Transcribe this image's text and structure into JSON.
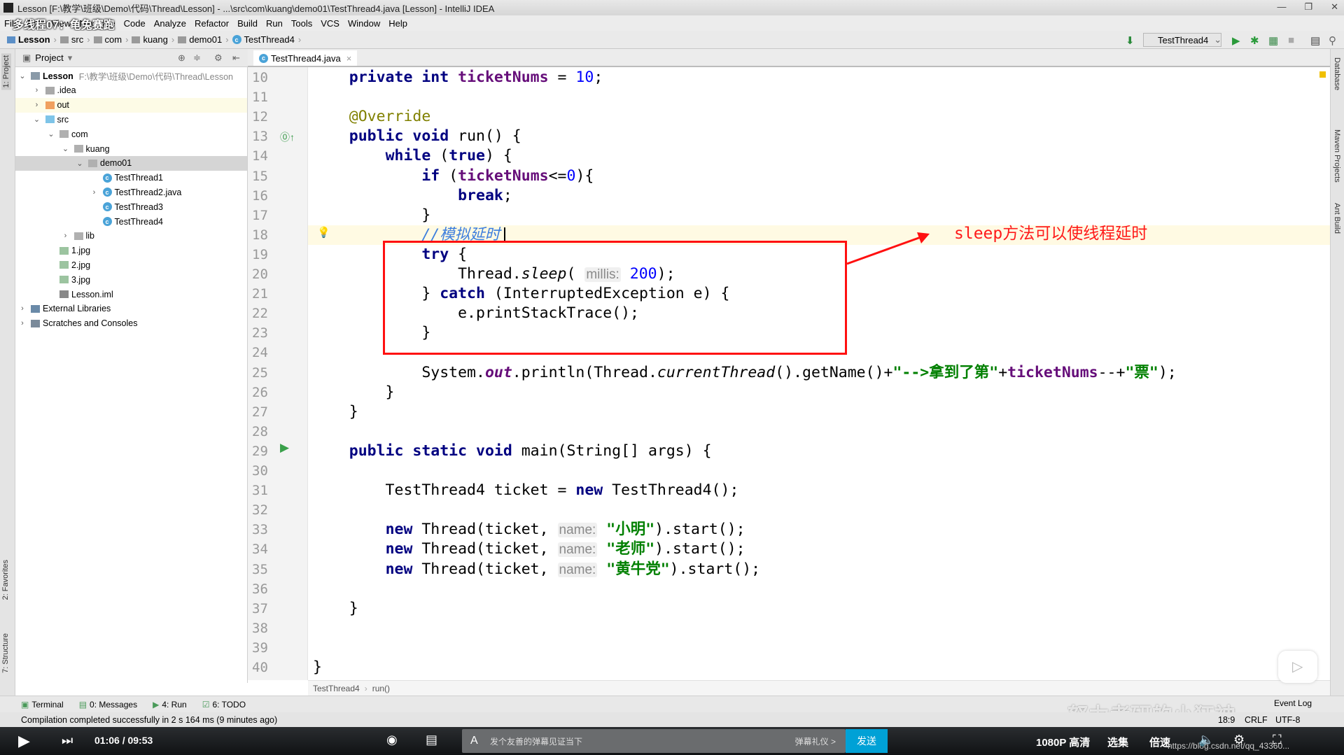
{
  "window": {
    "title": "Lesson [F:\\教学\\班级\\Demo\\代码\\Thread\\Lesson] - ...\\src\\com\\kuang\\demo01\\TestThread4.java [Lesson] - IntelliJ IDEA"
  },
  "video_title": "多线程07：龟兔赛跑",
  "menu": [
    "File",
    "Edit",
    "View",
    "Navigate",
    "Code",
    "Analyze",
    "Refactor",
    "Build",
    "Run",
    "Tools",
    "VCS",
    "Window",
    "Help"
  ],
  "breadcrumb": [
    "Lesson",
    "src",
    "com",
    "kuang",
    "demo01",
    "TestThread4"
  ],
  "run_config": "TestThread4",
  "side_tabs": {
    "project": "1: Project",
    "favorites": "2: Favorites",
    "structure": "7: Structure",
    "database": "Database",
    "maven": "Maven Projects",
    "ant": "Ant Build"
  },
  "project_panel": {
    "title": "Project",
    "tree": [
      {
        "label": "Lesson",
        "path": "F:\\教学\\班级\\Demo\\代码\\Thread\\Lesson",
        "level": 0,
        "arrow": "down",
        "icon": "module"
      },
      {
        "label": ".idea",
        "level": 1,
        "arrow": "right",
        "icon": "folder"
      },
      {
        "label": "out",
        "level": 1,
        "arrow": "right",
        "icon": "folder-orange"
      },
      {
        "label": "src",
        "level": 1,
        "arrow": "down",
        "icon": "folder-blue"
      },
      {
        "label": "com",
        "level": 2,
        "arrow": "down",
        "icon": "package"
      },
      {
        "label": "kuang",
        "level": 3,
        "arrow": "down",
        "icon": "package"
      },
      {
        "label": "demo01",
        "level": 4,
        "arrow": "down",
        "icon": "package",
        "selected": true
      },
      {
        "label": "TestThread1",
        "level": 5,
        "icon": "class"
      },
      {
        "label": "TestThread2.java",
        "level": 5,
        "arrow": "right",
        "icon": "class"
      },
      {
        "label": "TestThread3",
        "level": 5,
        "icon": "class"
      },
      {
        "label": "TestThread4",
        "level": 5,
        "icon": "class"
      },
      {
        "label": "lib",
        "level": 3,
        "arrow": "right",
        "icon": "package"
      },
      {
        "label": "1.jpg",
        "level": 2,
        "icon": "image"
      },
      {
        "label": "2.jpg",
        "level": 2,
        "icon": "image"
      },
      {
        "label": "3.jpg",
        "level": 2,
        "icon": "image"
      },
      {
        "label": "Lesson.iml",
        "level": 2,
        "icon": "iml"
      },
      {
        "label": "External Libraries",
        "level": 0,
        "arrow": "right",
        "icon": "libraries"
      },
      {
        "label": "Scratches and Consoles",
        "level": 0,
        "arrow": "right",
        "icon": "scratches"
      }
    ]
  },
  "editor": {
    "tab": "TestThread4.java",
    "first_line": 10,
    "caret_line": 18,
    "lines": [
      [
        [
          "    "
        ],
        [
          "private int ",
          "kw"
        ],
        [
          "ticketNums",
          "fld"
        ],
        [
          " = "
        ],
        [
          "10",
          "num"
        ],
        [
          ";"
        ]
      ],
      [],
      [
        [
          "    "
        ],
        [
          "@Override",
          "ann"
        ]
      ],
      [
        [
          "    "
        ],
        [
          "public void ",
          "kw"
        ],
        [
          "run() {"
        ]
      ],
      [
        [
          "        "
        ],
        [
          "while ",
          "kw"
        ],
        [
          "("
        ],
        [
          "true",
          "kw"
        ],
        [
          ") {"
        ]
      ],
      [
        [
          "            "
        ],
        [
          "if ",
          "kw"
        ],
        [
          "("
        ],
        [
          "ticketNums",
          "fld"
        ],
        [
          "<="
        ],
        [
          "0",
          "num"
        ],
        [
          "){"
        ]
      ],
      [
        [
          "                "
        ],
        [
          "break",
          "kw"
        ],
        [
          ";"
        ]
      ],
      [
        [
          "            }"
        ]
      ],
      [
        [
          "            "
        ],
        [
          "//模拟延时",
          "cmt"
        ]
      ],
      [
        [
          "            "
        ],
        [
          "try ",
          "kw"
        ],
        [
          "{"
        ]
      ],
      [
        [
          "                Thread."
        ],
        [
          "sleep",
          "ital"
        ],
        [
          "( "
        ],
        [
          "millis:",
          "hint"
        ],
        [
          " "
        ],
        [
          "200",
          "num"
        ],
        [
          ");"
        ]
      ],
      [
        [
          "            } "
        ],
        [
          "catch ",
          "kw"
        ],
        [
          "(InterruptedException e) {"
        ]
      ],
      [
        [
          "                e.printStackTrace();"
        ]
      ],
      [
        [
          "            }"
        ]
      ],
      [],
      [
        [
          "            System."
        ],
        [
          "out",
          "ifld"
        ],
        [
          ".println(Thread."
        ],
        [
          "currentThread",
          "ital"
        ],
        [
          "().getName()+"
        ],
        [
          "\"-->拿到了第\"",
          "str"
        ],
        [
          "+"
        ],
        [
          "ticketNums",
          "fld"
        ],
        [
          "--+"
        ],
        [
          "\"票\"",
          "str"
        ],
        [
          ");"
        ]
      ],
      [
        [
          "        }"
        ]
      ],
      [
        [
          "    }"
        ]
      ],
      [],
      [
        [
          "    "
        ],
        [
          "public static void ",
          "kw"
        ],
        [
          "main(String[] args) {"
        ]
      ],
      [],
      [
        [
          "        TestThread4 ticket = "
        ],
        [
          "new ",
          "kw"
        ],
        [
          "TestThread4();"
        ]
      ],
      [],
      [
        [
          "        "
        ],
        [
          "new ",
          "kw"
        ],
        [
          "Thread(ticket, "
        ],
        [
          "name:",
          "hint"
        ],
        [
          " "
        ],
        [
          "\"小明\"",
          "str"
        ],
        [
          ").start();"
        ]
      ],
      [
        [
          "        "
        ],
        [
          "new ",
          "kw"
        ],
        [
          "Thread(ticket, "
        ],
        [
          "name:",
          "hint"
        ],
        [
          " "
        ],
        [
          "\"老师\"",
          "str"
        ],
        [
          ").start();"
        ]
      ],
      [
        [
          "        "
        ],
        [
          "new ",
          "kw"
        ],
        [
          "Thread(ticket, "
        ],
        [
          "name:",
          "hint"
        ],
        [
          " "
        ],
        [
          "\"黄牛党\"",
          "str"
        ],
        [
          ").start();"
        ]
      ],
      [],
      [
        [
          "    }"
        ]
      ],
      [],
      [],
      [
        [
          "}"
        ]
      ]
    ],
    "breadcrumb": [
      "TestThread4",
      "run()"
    ]
  },
  "annotation": {
    "text": "sleep方法可以使线程延时",
    "color": "#ff1a1a"
  },
  "bottom_tabs": [
    "Terminal",
    "0: Messages",
    "4: Run",
    "6: TODO"
  ],
  "event_log": "Event Log",
  "status": {
    "message": "Compilation completed successfully in 2 s 164 ms (9 minutes ago)",
    "position": "18:9",
    "line_sep": "CRLF",
    "encoding": "UTF-8"
  },
  "player": {
    "time": "01:06 / 09:53",
    "danmu_placeholder": "发个友善的弹幕见证当下",
    "danmu_etiquette": "弹幕礼仪 >",
    "send": "发送",
    "quality": "1080P 高清",
    "episodes": "选集",
    "speed": "倍速",
    "url": "https://blog.csdn.net/qq_43360..."
  },
  "watermark": "努力考研的小狂神"
}
